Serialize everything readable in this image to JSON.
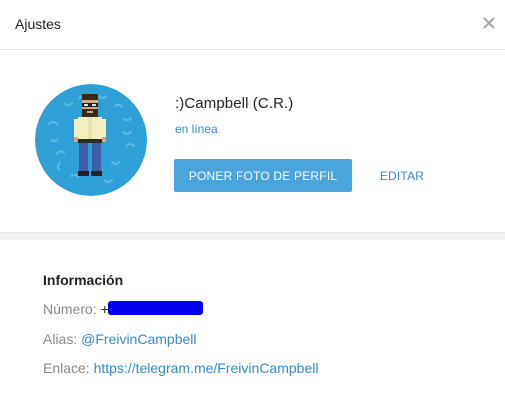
{
  "header": {
    "title": "Ajustes",
    "close_icon": "close-icon"
  },
  "profile": {
    "avatar_icon": "avatar",
    "name": ":)Campbell (C.R.)",
    "status": "en línea",
    "set_photo_label": "PONER FOTO DE PERFIL",
    "edit_label": "EDITAR"
  },
  "info": {
    "heading": "Información",
    "phone_label": "Número:",
    "phone_value": "+",
    "alias_label": "Alias:",
    "alias_value": "@FreivinCampbell",
    "link_label": "Enlace:",
    "link_value": "https://telegram.me/FreivinCampbell"
  },
  "colors": {
    "accent": "#4aa5dd",
    "link": "#3a8bc5",
    "redaction": "#0000ee"
  }
}
